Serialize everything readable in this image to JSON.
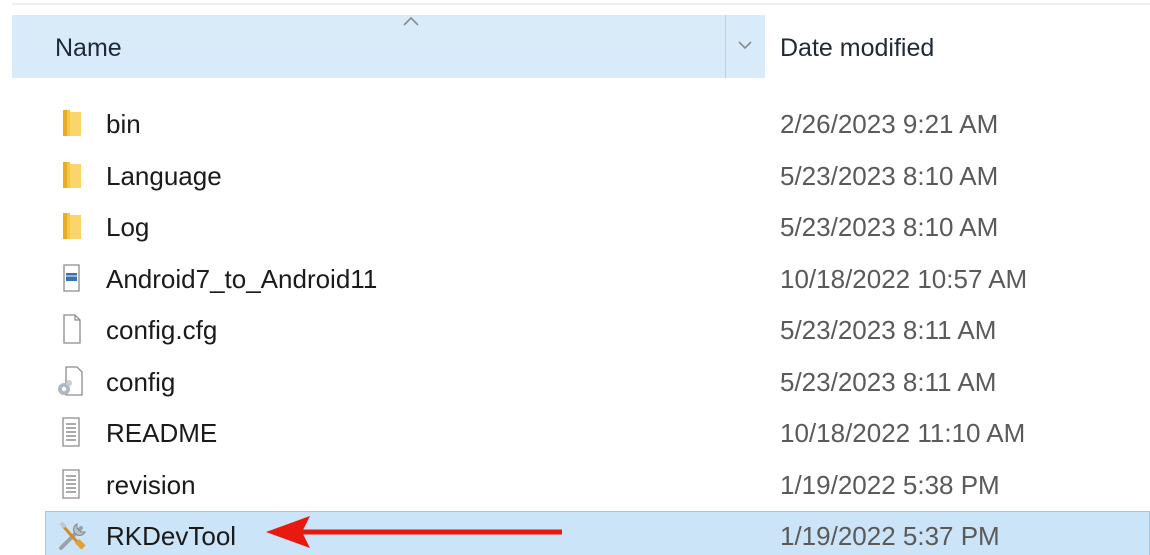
{
  "header": {
    "name_label": "Name",
    "date_label": "Date modified"
  },
  "colors": {
    "header_bg": "#d9ebf9",
    "selection_bg": "#cce4f7",
    "folder": "#f8c544",
    "arrow": "#e8190f"
  },
  "files": [
    {
      "name": "bin",
      "date": "2/26/2023 9:21 AM",
      "icon": "folder-icon"
    },
    {
      "name": "Language",
      "date": "5/23/2023 8:10 AM",
      "icon": "folder-icon"
    },
    {
      "name": "Log",
      "date": "5/23/2023 8:10 AM",
      "icon": "folder-icon"
    },
    {
      "name": "Android7_to_Android11",
      "date": "10/18/2022 10:57 AM",
      "icon": "image-file-icon"
    },
    {
      "name": "config.cfg",
      "date": "5/23/2023 8:11 AM",
      "icon": "blank-file-icon"
    },
    {
      "name": "config",
      "date": "5/23/2023 8:11 AM",
      "icon": "settings-file-icon"
    },
    {
      "name": "README",
      "date": "10/18/2022 11:10 AM",
      "icon": "text-file-icon"
    },
    {
      "name": "revision",
      "date": "1/19/2022 5:38 PM",
      "icon": "text-file-icon"
    },
    {
      "name": "RKDevTool",
      "date": "1/19/2022 5:37 PM",
      "icon": "tools-app-icon",
      "selected": true
    }
  ]
}
